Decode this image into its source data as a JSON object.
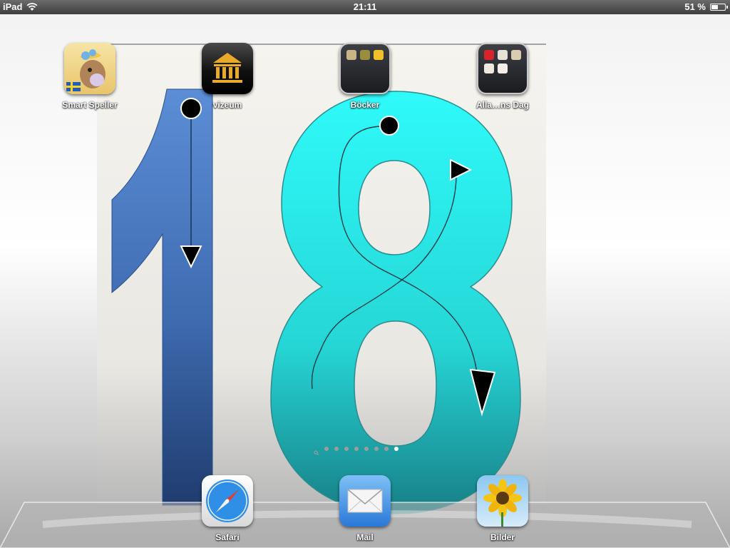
{
  "status_bar": {
    "device": "iPad",
    "time": "21:11",
    "battery": "51 %",
    "battery_level": 0.51
  },
  "wallpaper": {
    "colors": {
      "one": "#4f86d0",
      "eight": "#2ff0f0"
    }
  },
  "home_apps": [
    {
      "label": "Smart Speller"
    },
    {
      "label": "vizeum"
    },
    {
      "label": "Böcker"
    },
    {
      "label": "Alla…ns Dag"
    }
  ],
  "page_indicator": {
    "pages": 9,
    "current": 9
  },
  "dock_apps": [
    {
      "label": "Safari"
    },
    {
      "label": "Mail"
    },
    {
      "label": "Bilder"
    }
  ]
}
